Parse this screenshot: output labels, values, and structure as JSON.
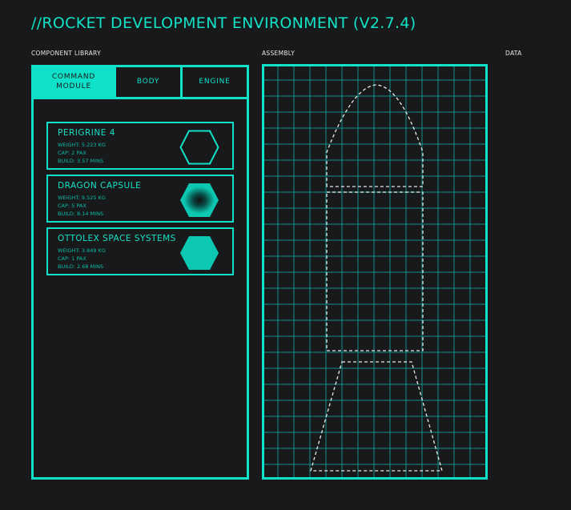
{
  "header": {
    "title": "//ROCKET DEVELOPMENT ENVIRONMENT (V2.7.4)"
  },
  "sections": {
    "library": "COMPONENT LIBRARY",
    "assembly": "ASSEMBLY",
    "data": "DATA"
  },
  "tabs": [
    {
      "label": "COMMAND MODULE",
      "active": true
    },
    {
      "label": "BODY"
    },
    {
      "label": "ENGINE"
    }
  ],
  "components": [
    {
      "name": "PERIGRINE 4",
      "weight": "WEIGHT: 5.223 KG",
      "cap": "CAP: 2 PAX",
      "build": "BUILD: 3.57 MINS",
      "icon": "hexagon-outline-icon"
    },
    {
      "name": "DRAGON CAPSULE",
      "weight": "WEIGHT: 9.525 KG",
      "cap": "CAP: 5 PAX",
      "build": "BUILD: 8.14 MINS",
      "icon": "hexagon-radial-icon"
    },
    {
      "name": "OTTOLEX SPACE SYSTEMS",
      "weight": "WEIGHT: 3.849 KG",
      "cap": "CAP: 1 PAX",
      "build": "BUILD: 2.68 MINS",
      "icon": "hexagon-filled-icon"
    }
  ],
  "colors": {
    "accent": "#0fe0c8",
    "background": "#18191b"
  }
}
